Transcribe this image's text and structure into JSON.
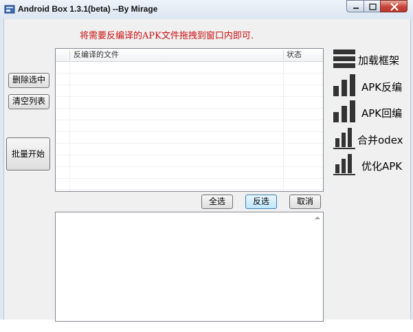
{
  "window": {
    "title": "Android Box 1.3.1(beta) --By Mirage"
  },
  "hint": "将需要反编译的APK文件拖拽到窗口内即可.",
  "left_buttons": {
    "delete_selected": "删除选中",
    "clear_list": "清空列表",
    "batch_start": "批量开始"
  },
  "file_list": {
    "columns": [
      "反编译的文件",
      "状态"
    ],
    "rows": []
  },
  "list_actions": {
    "select_all": "全选",
    "invert_selection": "反选",
    "cancel": "取消"
  },
  "menu": [
    {
      "label": "加载框架",
      "icon": "stacked-bars-icon"
    },
    {
      "label": "APK反编",
      "icon": "bar-chart-icon"
    },
    {
      "label": "APK回编",
      "icon": "bar-chart-icon"
    },
    {
      "label": "合并odex",
      "icon": "bar-chart-underline-icon"
    },
    {
      "label": "优化APK",
      "icon": "bar-chart-underline-icon"
    }
  ]
}
